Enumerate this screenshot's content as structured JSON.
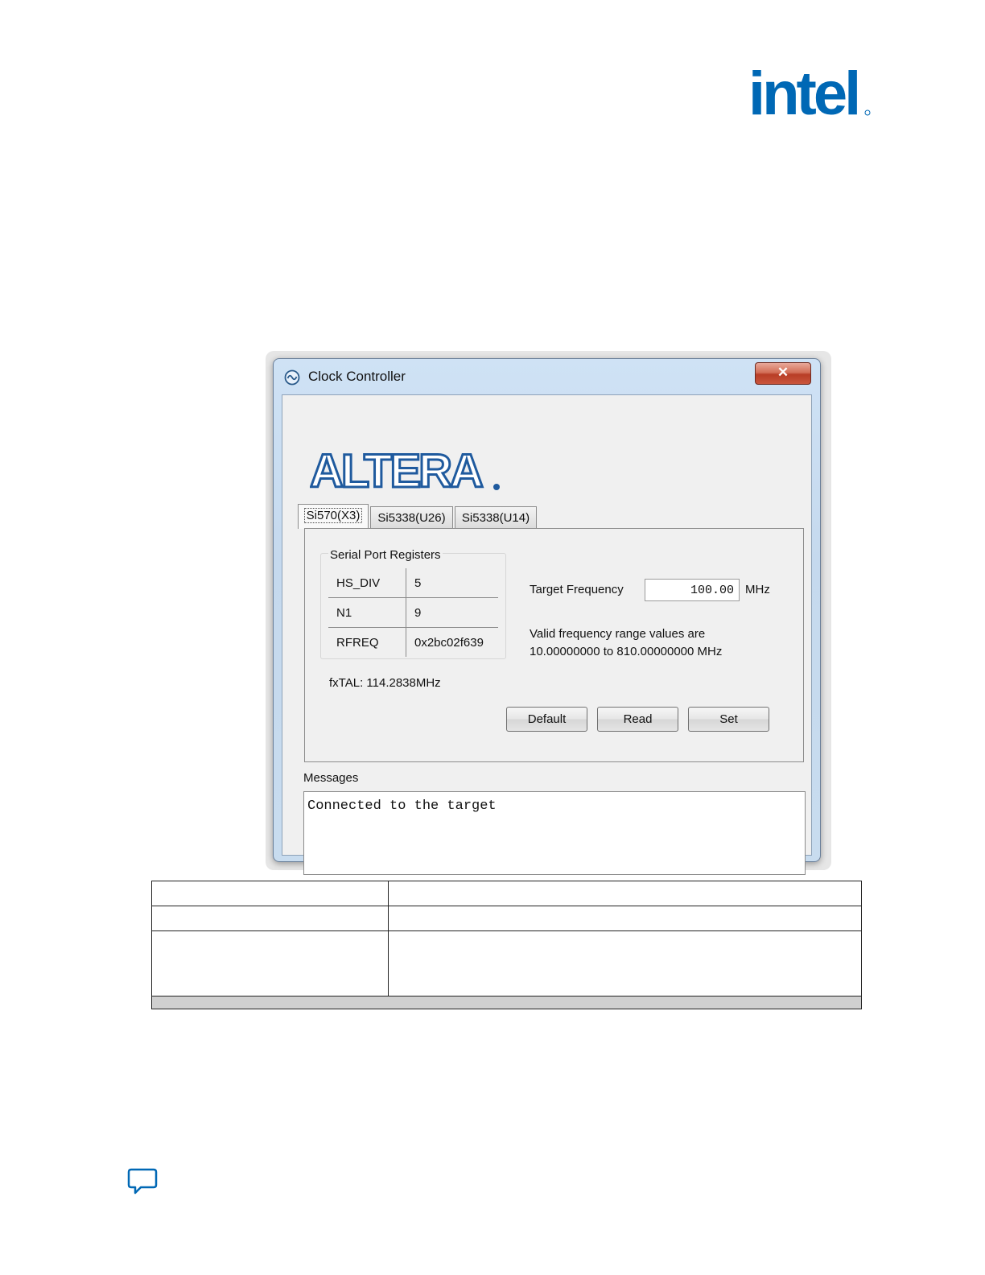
{
  "brand": {
    "logo_text": "intel",
    "accent_color": "#0068B5"
  },
  "window": {
    "title": "Clock Controller",
    "title_icon": "clock-icon",
    "close_label": "✕",
    "company_logo": "ALTERA"
  },
  "tabs": [
    {
      "label": "Si570(X3)",
      "active": true
    },
    {
      "label": "Si5338(U26)",
      "active": false
    },
    {
      "label": "Si5338(U14)",
      "active": false
    }
  ],
  "registers": {
    "legend": "Serial Port Registers",
    "rows": [
      {
        "name": "HS_DIV",
        "value": "5"
      },
      {
        "name": "N1",
        "value": "9"
      },
      {
        "name": "RFREQ",
        "value": "0x2bc02f639"
      }
    ],
    "fxtal": "fxTAL: 114.2838MHz"
  },
  "target": {
    "label": "Target Frequency",
    "value": "100.00",
    "unit": "MHz",
    "range_line1": "Valid frequency range values are",
    "range_line2": "10.00000000 to 810.00000000 MHz"
  },
  "buttons": {
    "default": "Default",
    "read": "Read",
    "set": "Set"
  },
  "messages": {
    "label": "Messages",
    "text": "Connected to the target"
  },
  "footer": {
    "feedback_icon": "feedback-icon"
  }
}
